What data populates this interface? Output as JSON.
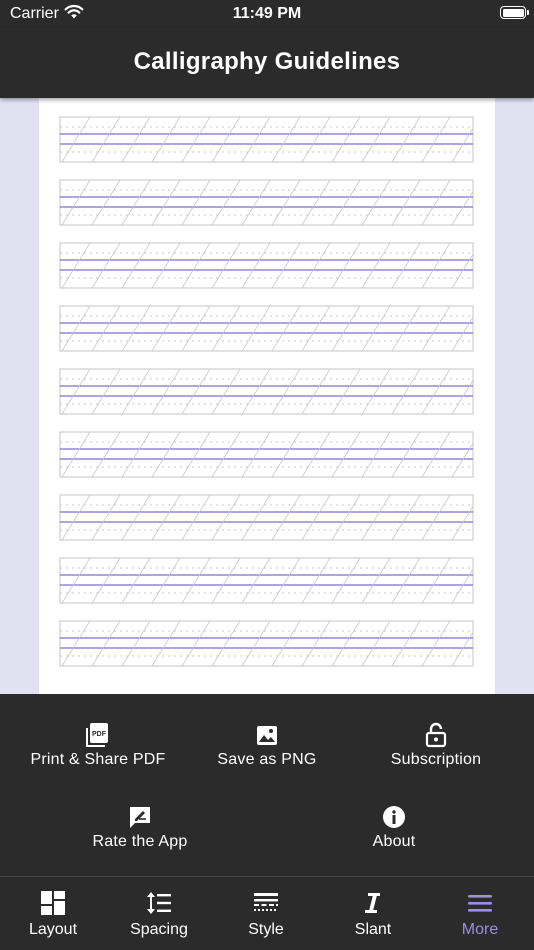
{
  "status_bar": {
    "carrier": "Carrier",
    "time": "11:49 PM"
  },
  "header": {
    "title": "Calligraphy Guidelines"
  },
  "sheet": {
    "guide_row_count": 9,
    "line_color": "#7a6fd0",
    "slant_color": "#c8c8c8"
  },
  "actions": {
    "print_pdf": {
      "label": "Print & Share PDF",
      "icon": "pdf-icon"
    },
    "save_png": {
      "label": "Save as PNG",
      "icon": "image-icon"
    },
    "subscription": {
      "label": "Subscription",
      "icon": "unlock-icon"
    },
    "rate": {
      "label": "Rate the App",
      "icon": "rate-icon"
    },
    "about": {
      "label": "About",
      "icon": "info-icon"
    }
  },
  "tabs": [
    {
      "label": "Layout",
      "icon": "layout-icon",
      "active": false
    },
    {
      "label": "Spacing",
      "icon": "spacing-icon",
      "active": false
    },
    {
      "label": "Style",
      "icon": "style-icon",
      "active": false
    },
    {
      "label": "Slant",
      "icon": "slant-icon",
      "active": false
    },
    {
      "label": "More",
      "icon": "menu-icon",
      "active": true
    }
  ],
  "colors": {
    "accent": "#9a8fe0",
    "bar_bg": "#2b2b2b",
    "canvas_bg": "#e2e1f2"
  }
}
